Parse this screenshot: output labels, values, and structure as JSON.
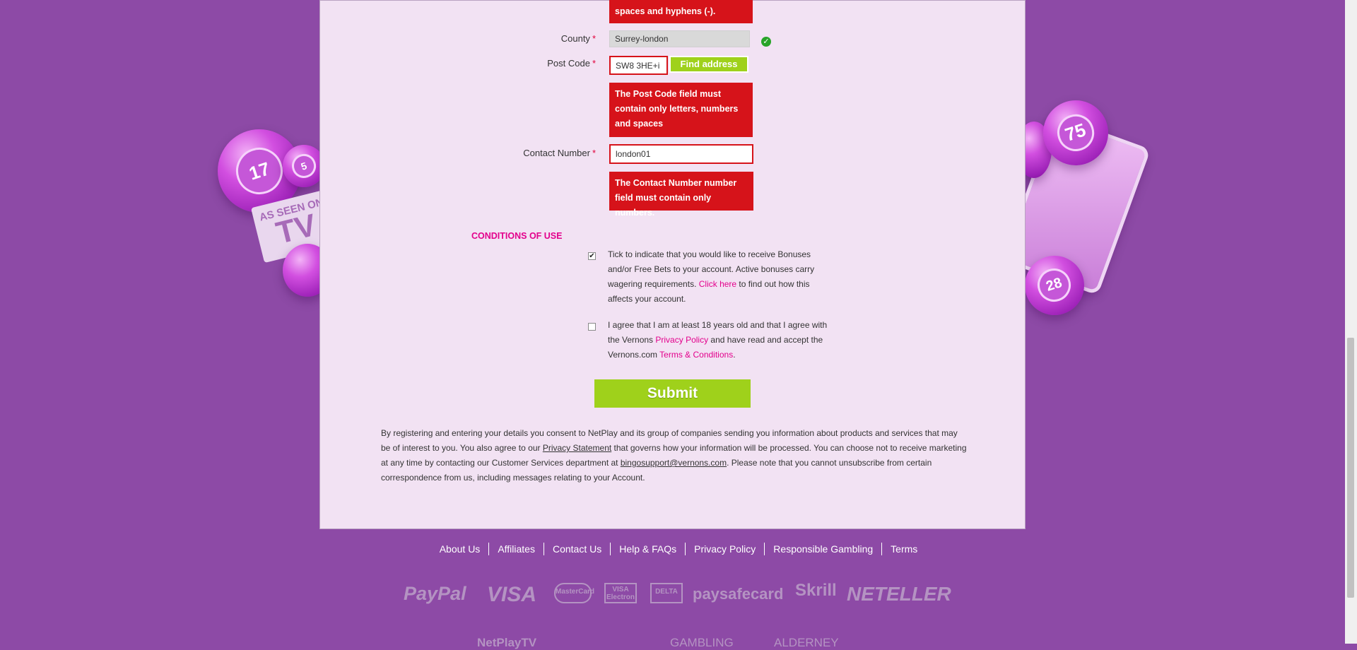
{
  "form": {
    "prev_error_tail": "spaces and hyphens (-).",
    "county": {
      "label": "County",
      "required": "*",
      "value": "Surrey-london"
    },
    "postcode": {
      "label": "Post Code",
      "required": "*",
      "value": "SW8 3HE+i",
      "find_button": "Find address",
      "error": "The Post Code field must contain only letters, numbers and spaces"
    },
    "contact": {
      "label": "Contact Number",
      "required": "*",
      "value": "london01",
      "error": "The Contact Number number field must contain only numbers."
    }
  },
  "conditions": {
    "title": "CONDITIONS OF USE",
    "bonus": {
      "checked": true,
      "text_before": "Tick to indicate that you would like to receive Bonuses and/or Free Bets to your account. Active bonuses carry wagering requirements. ",
      "link": "Click here",
      "text_after": " to find out how this affects your account."
    },
    "age": {
      "checked": false,
      "text_1": "I agree that I am at least 18 years old and that I agree with the Vernons ",
      "link_privacy": "Privacy Policy",
      "text_2": " and have read and accept the Vernons.com ",
      "link_terms": "Terms & Conditions",
      "text_3": "."
    }
  },
  "submit_label": "Submit",
  "consent": {
    "part1": "By registering and entering your details you consent to NetPlay and its group of companies sending you information about products and services that may be of interest to you. You also agree to our ",
    "privacy_statement": "Privacy Statement",
    "part2": " that governs how your information will be processed. You can choose not to receive marketing at any time by contacting our Customer Services department at ",
    "email": "bingosupport@vernons.com",
    "part3": ". Please note that you cannot unsubscribe from certain correspondence from us, including messages relating to your Account."
  },
  "footer": {
    "links": [
      "About Us",
      "Affiliates",
      "Contact Us",
      "Help & FAQs",
      "Privacy Policy",
      "Responsible Gambling",
      "Terms"
    ]
  },
  "payments": {
    "paypal": "PayPal",
    "visa": "VISA",
    "mastercard": "MasterCard",
    "visa_electron": "VISA Electron",
    "delta": "DELTA",
    "paysafecard": "paysafecard",
    "skrill": "Skrill",
    "neteller": "NETELLER"
  },
  "bottom_logos": {
    "netplay": "NetPlayTV",
    "gambling": "GAMBLING",
    "alderney": "ALDERNEY"
  },
  "decor": {
    "ball_numbers": [
      "17",
      "5",
      "75",
      "28"
    ],
    "tv_badge_small": "AS SEEN ON",
    "tv_badge_big": "TV"
  },
  "colors": {
    "background": "#8d4aa6",
    "panel": "#f2e2f3",
    "error": "#d6131a",
    "accent_pink": "#e3008c",
    "button_green": "#9fd11b",
    "success_green": "#28a428"
  }
}
